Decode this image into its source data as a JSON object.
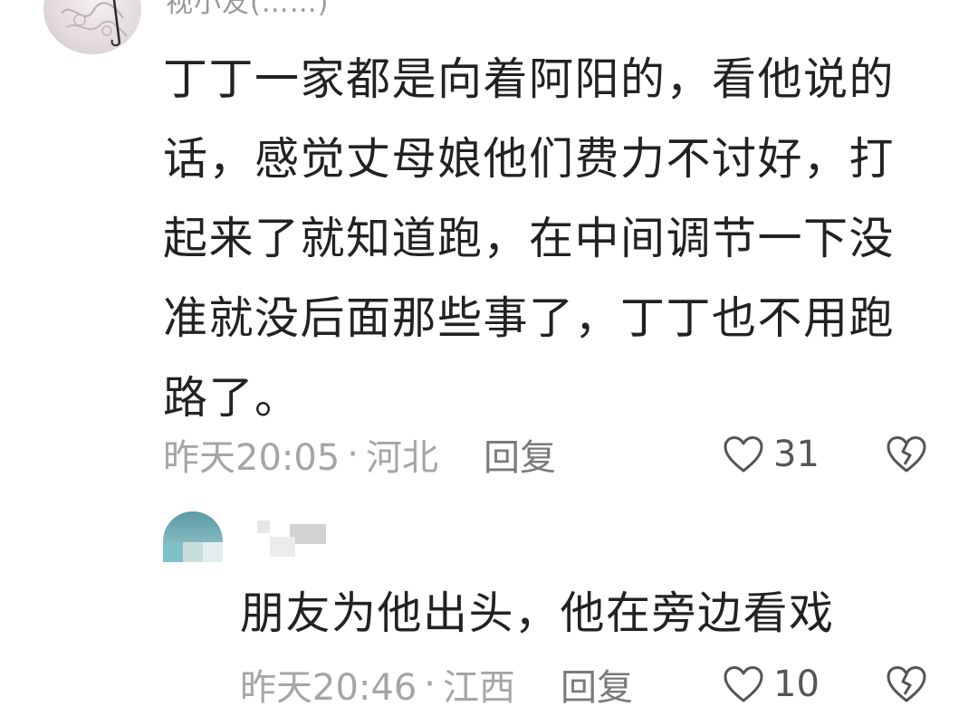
{
  "comments": [
    {
      "username": "视小友(……)",
      "text": "丁丁一家都是向着阿阳的，看他说的话，感觉丈母娘他们费力不讨好，打起来了就知道跑，在中间调节一下没准就没后面那些事了，丁丁也不用跑路了。",
      "time": "昨天20:05",
      "separator": "·",
      "location": "河北",
      "reply_label": "回复",
      "likes": "31",
      "like_icon": "heart-outline-icon",
      "dislike_icon": "broken-heart-icon"
    }
  ],
  "reply": {
    "text": "朋友为他出头，他在旁边看戏",
    "time": "昨天20:46",
    "separator": "·",
    "location": "江西",
    "reply_label": "回复",
    "likes": "10",
    "like_icon": "heart-outline-icon",
    "dislike_icon": "broken-heart-icon"
  },
  "colors": {
    "text_primary": "#222222",
    "text_meta": "#a5a5a5",
    "reply_button": "#7a7a7a",
    "icon": "#555555",
    "reply_avatar": "#5a9aa6"
  }
}
